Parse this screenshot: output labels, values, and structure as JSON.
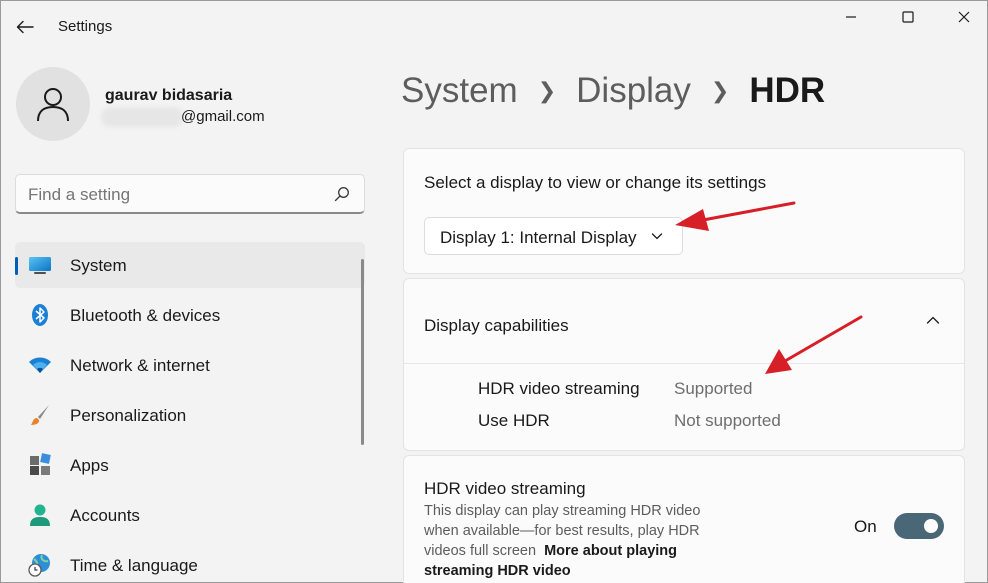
{
  "window": {
    "title": "Settings"
  },
  "profile": {
    "name": "gaurav bidasaria",
    "email": "@gmail.com"
  },
  "search": {
    "placeholder": "Find a setting"
  },
  "sidebar": {
    "items": [
      {
        "label": "System",
        "icon": "monitor-icon",
        "active": true
      },
      {
        "label": "Bluetooth & devices",
        "icon": "bluetooth-icon"
      },
      {
        "label": "Network & internet",
        "icon": "wifi-icon"
      },
      {
        "label": "Personalization",
        "icon": "brush-icon"
      },
      {
        "label": "Apps",
        "icon": "apps-icon"
      },
      {
        "label": "Accounts",
        "icon": "person-icon"
      },
      {
        "label": "Time & language",
        "icon": "globe-clock-icon"
      }
    ]
  },
  "breadcrumb": [
    "System",
    "Display",
    "HDR"
  ],
  "display_select": {
    "label": "Select a display to view or change its settings",
    "value": "Display 1: Internal Display"
  },
  "capabilities": {
    "title": "Display capabilities",
    "rows": [
      {
        "name": "HDR video streaming",
        "value": "Supported"
      },
      {
        "name": "Use HDR",
        "value": "Not supported"
      }
    ]
  },
  "hdr_streaming": {
    "title": "HDR video streaming",
    "description": "This display can play streaming HDR video when available—for best results, play HDR videos full screen",
    "link": "More about playing streaming HDR video",
    "toggle_label": "On",
    "toggle_on": true
  },
  "colors": {
    "accent": "#005fb8",
    "toggle_on": "#4a6778",
    "annotation_arrow": "#d61f26"
  }
}
